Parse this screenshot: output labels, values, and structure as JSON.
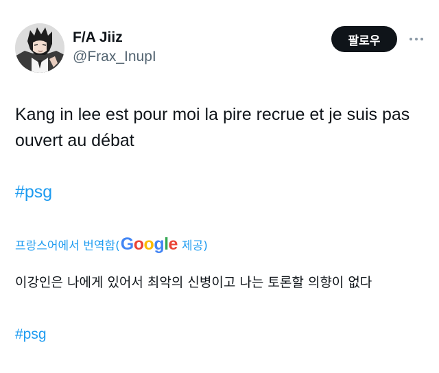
{
  "tweet": {
    "author": {
      "display_name": "F/A Jiiz",
      "handle": "@Frax_InupI",
      "avatar_icon": "anime-character-avatar"
    },
    "follow_label": "팔로우",
    "more_icon": "more-options-icon",
    "text": "Kang in lee est pour moi la pire recrue et je suis pas ouvert au débat",
    "hashtag": "#psg",
    "translation": {
      "prefix": "프랑스어에서 번역함(",
      "provider_letters": [
        "G",
        "o",
        "o",
        "g",
        "l",
        "e"
      ],
      "suffix": " 제공)",
      "text": "이강인은 나에게 있어서 최악의 신병이고 나는 토론할 의향이 없다",
      "hashtag": "#psg"
    }
  },
  "colors": {
    "accent": "#1d9bf0",
    "text": "#0f1419",
    "secondary": "#536471",
    "google_blue": "#4285f4",
    "google_red": "#ea4335",
    "google_yellow": "#fbbc05",
    "google_green": "#34a853"
  }
}
